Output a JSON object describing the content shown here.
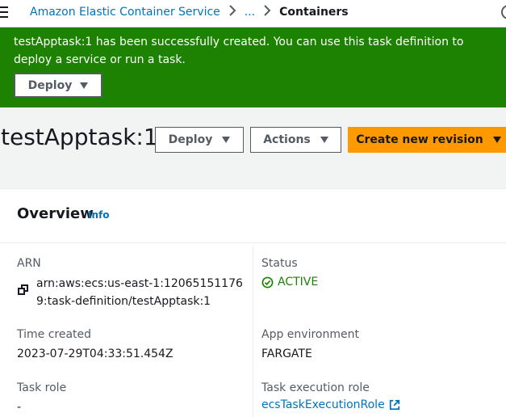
{
  "breadcrumb": {
    "items": [
      "Amazon Elastic Container Service",
      "..."
    ],
    "current": "Containers"
  },
  "flash": {
    "message": "testApptask:1 has been successfully created. You can use this task definition to deploy a service or run a task.",
    "deploy_label": "Deploy",
    "color": "#1d8102"
  },
  "header": {
    "title": "testApptask:1",
    "deploy_label": "Deploy",
    "actions_label": "Actions",
    "create_label": "Create new revision",
    "primary_color": "#ff9900"
  },
  "overview": {
    "title": "Overview",
    "info_label": "Info",
    "arn_label": "ARN",
    "arn_value": "arn:aws:ecs:us-east-1:120651511769:task-definition/testApptask:1",
    "status_label": "Status",
    "status_value": "ACTIVE",
    "time_label": "Time created",
    "time_value": "2023-07-29T04:33:51.454Z",
    "env_label": "App environment",
    "env_value": "FARGATE",
    "task_role_label": "Task role",
    "task_role_value": "-",
    "exec_role_label": "Task execution role",
    "exec_role_value": "ecsTaskExecutionRole"
  },
  "icons": {
    "menu": "menu-icon",
    "help": "help-icon",
    "copy": "copy-icon",
    "status": "check-circle-icon",
    "external": "external-link-icon"
  }
}
